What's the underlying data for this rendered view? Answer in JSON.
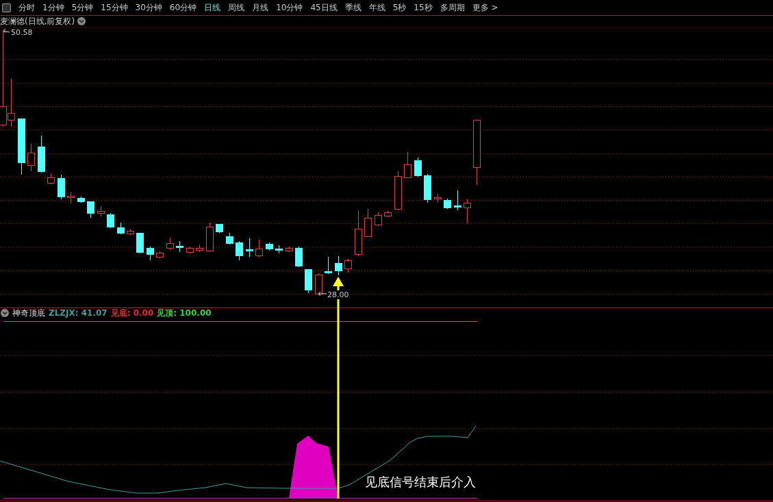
{
  "period_tabs": [
    {
      "label": "分时",
      "selected": false
    },
    {
      "label": "1分钟",
      "selected": false
    },
    {
      "label": "5分钟",
      "selected": false
    },
    {
      "label": "15分钟",
      "selected": false
    },
    {
      "label": "30分钟",
      "selected": false
    },
    {
      "label": "60分钟",
      "selected": false
    },
    {
      "label": "日线",
      "selected": true
    },
    {
      "label": "周线",
      "selected": false
    },
    {
      "label": "月线",
      "selected": false
    },
    {
      "label": "10分钟",
      "selected": false
    },
    {
      "label": "45日线",
      "selected": false
    },
    {
      "label": "季线",
      "selected": false
    },
    {
      "label": "年线",
      "selected": false
    },
    {
      "label": "5秒",
      "selected": false
    },
    {
      "label": "15秒",
      "selected": false
    },
    {
      "label": "多周期",
      "selected": false
    },
    {
      "label": "更多 >",
      "selected": false
    }
  ],
  "price_chart": {
    "title": "麦澜德(日线,前复权)",
    "high_label": "50.58",
    "low_label": "28.00"
  },
  "indicator": {
    "name": "神奇顶底",
    "values": [
      {
        "label": "ZLZJX:",
        "value": "41.07",
        "color": "#4a9a9a"
      },
      {
        "label": "见底:",
        "value": "0.00",
        "color": "#e03030"
      },
      {
        "label": "见顶:",
        "value": "100.00",
        "color": "#40d040"
      }
    ],
    "annotation": "见底信号结束后介入"
  }
}
